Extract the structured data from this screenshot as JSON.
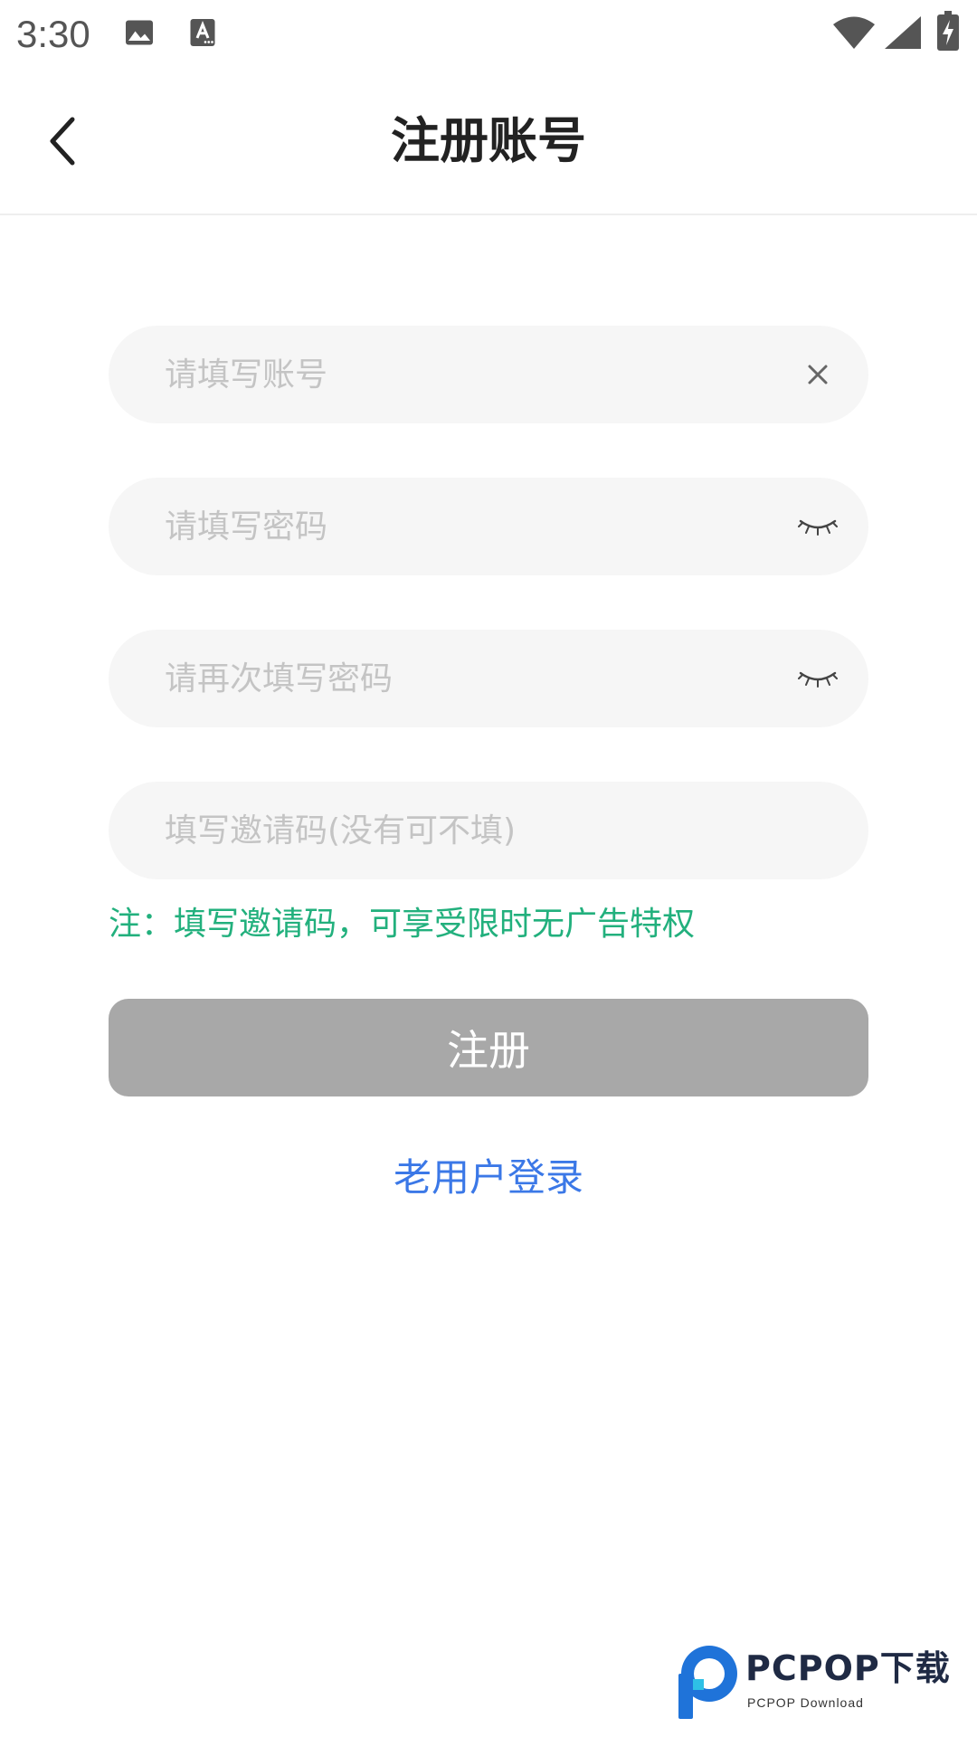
{
  "status_bar": {
    "time": "3:30",
    "icons": [
      "photo-icon",
      "text-a-icon",
      "wifi-icon",
      "cell-signal-icon",
      "battery-charging-icon"
    ]
  },
  "header": {
    "title": "注册账号",
    "back_icon": "chevron-left-icon"
  },
  "form": {
    "account": {
      "value": "",
      "placeholder": "请填写账号",
      "action_icon": "clear-icon"
    },
    "password": {
      "value": "",
      "placeholder": "请填写密码",
      "action_icon": "eye-closed-icon"
    },
    "password_confirm": {
      "value": "",
      "placeholder": "请再次填写密码",
      "action_icon": "eye-closed-icon"
    },
    "invite_code": {
      "value": "",
      "placeholder": "填写邀请码(没有可不填)"
    },
    "note": "注：填写邀请码，可享受限时无广告特权",
    "submit_label": "注册",
    "login_link": "老用户登录"
  },
  "watermark": {
    "main": "PCPOP下载",
    "sub": "PCPOP Download"
  },
  "colors": {
    "note_green": "#22b07d",
    "link_blue": "#3b78e7",
    "button_disabled": "#a8a8a8",
    "field_bg": "#f6f6f6",
    "watermark_blue": "#1f73d9"
  }
}
